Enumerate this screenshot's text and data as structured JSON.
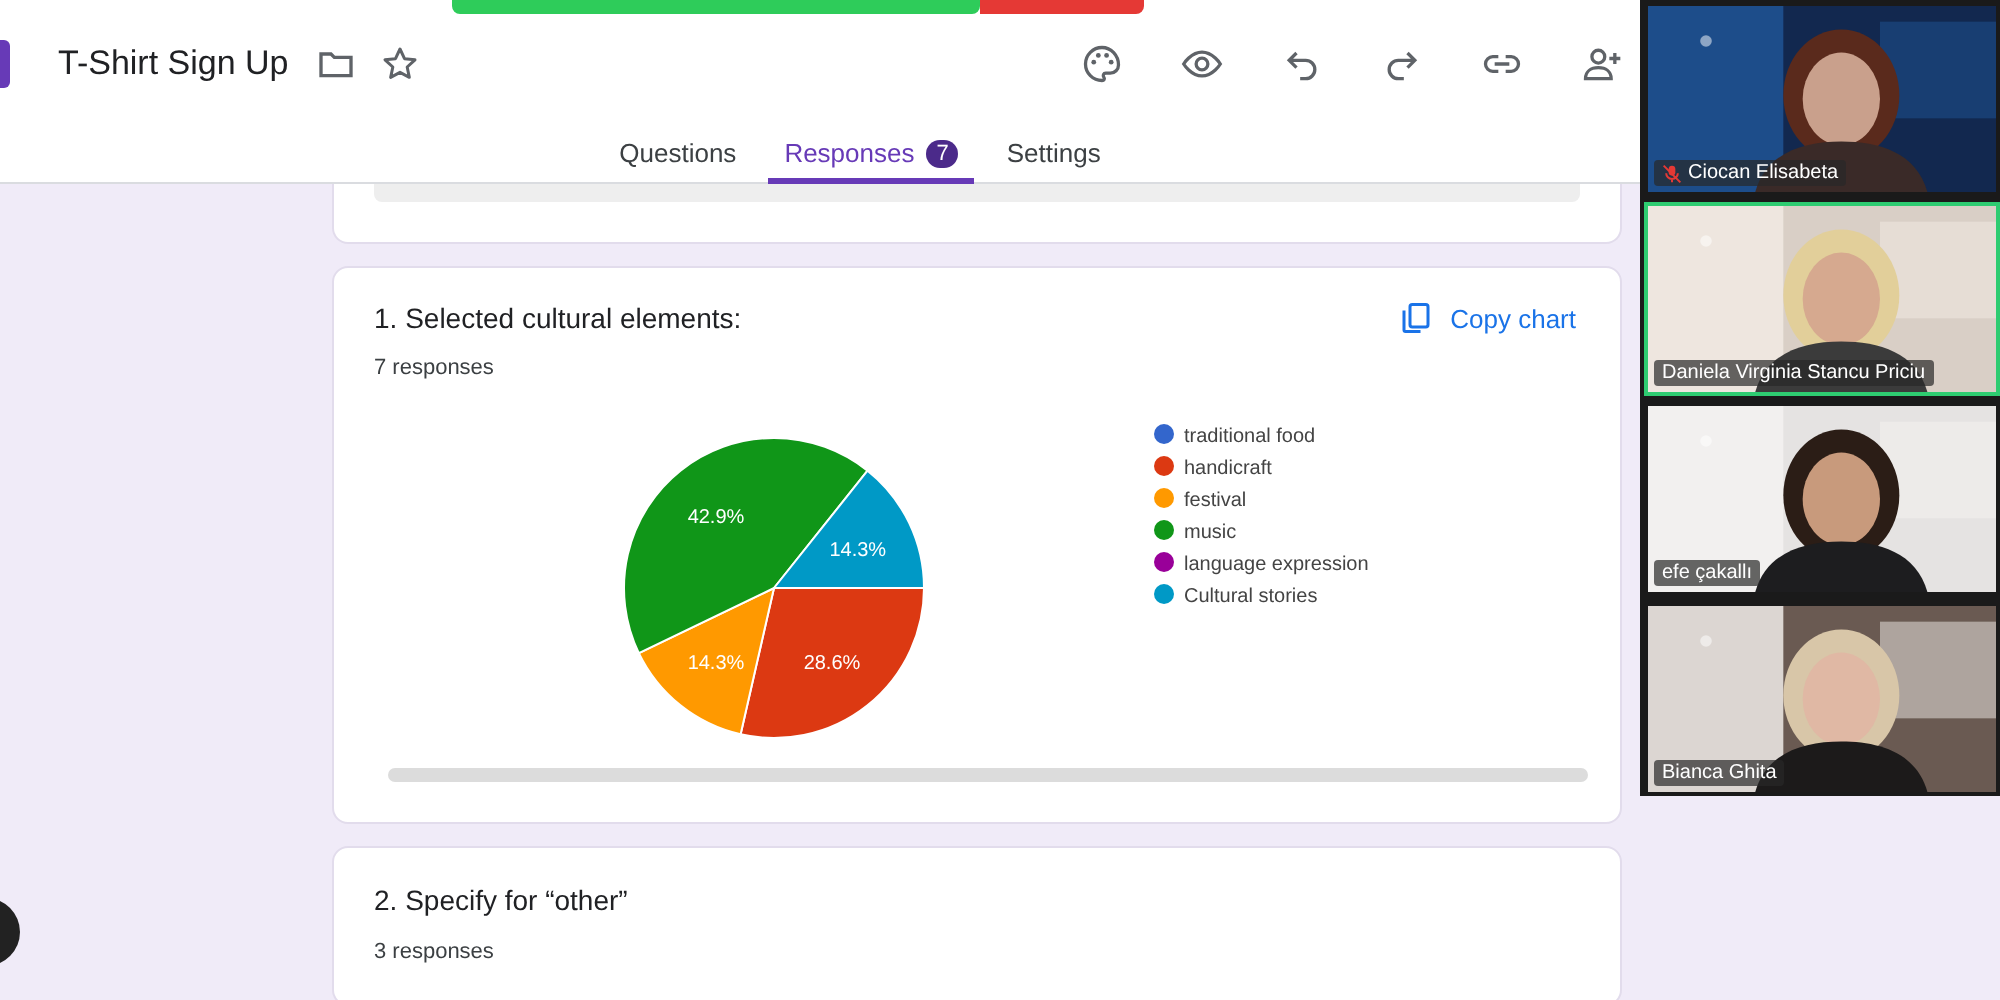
{
  "form": {
    "title": "T-Shirt Sign Up"
  },
  "tabs": [
    {
      "label": "Questions",
      "selected": false
    },
    {
      "label": "Responses",
      "selected": true,
      "badge": "7"
    },
    {
      "label": "Settings",
      "selected": false
    }
  ],
  "questions": [
    {
      "title": "1. Selected cultural elements:",
      "count": "7 responses",
      "copy_label": "Copy chart",
      "chart_data": {
        "type": "pie",
        "categories": [
          "traditional food",
          "handicraft",
          "festival",
          "music",
          "language expression",
          "Cultural stories"
        ],
        "values": [
          0,
          28.6,
          14.3,
          42.9,
          0,
          14.3
        ],
        "legend": "right",
        "colors": [
          "#3366cc",
          "#dc3912",
          "#ff9900",
          "#109618",
          "#990099",
          "#0099c6"
        ],
        "value_labels": [
          null,
          "28.6%",
          "14.3%",
          "42.9%",
          null,
          "14.3%"
        ],
        "data_labels": true
      }
    },
    {
      "title": "2. Specify for “other”",
      "count": "3 responses"
    }
  ],
  "participants": [
    {
      "name": "Ciocan Elisabeta",
      "muted": true,
      "selected": false
    },
    {
      "name": "Daniela Virginia Stancu Priciu",
      "muted": false,
      "selected": true
    },
    {
      "name": "efe çakallı",
      "muted": false,
      "selected": false
    },
    {
      "name": "Bianca Ghita",
      "muted": false,
      "selected": false
    }
  ]
}
